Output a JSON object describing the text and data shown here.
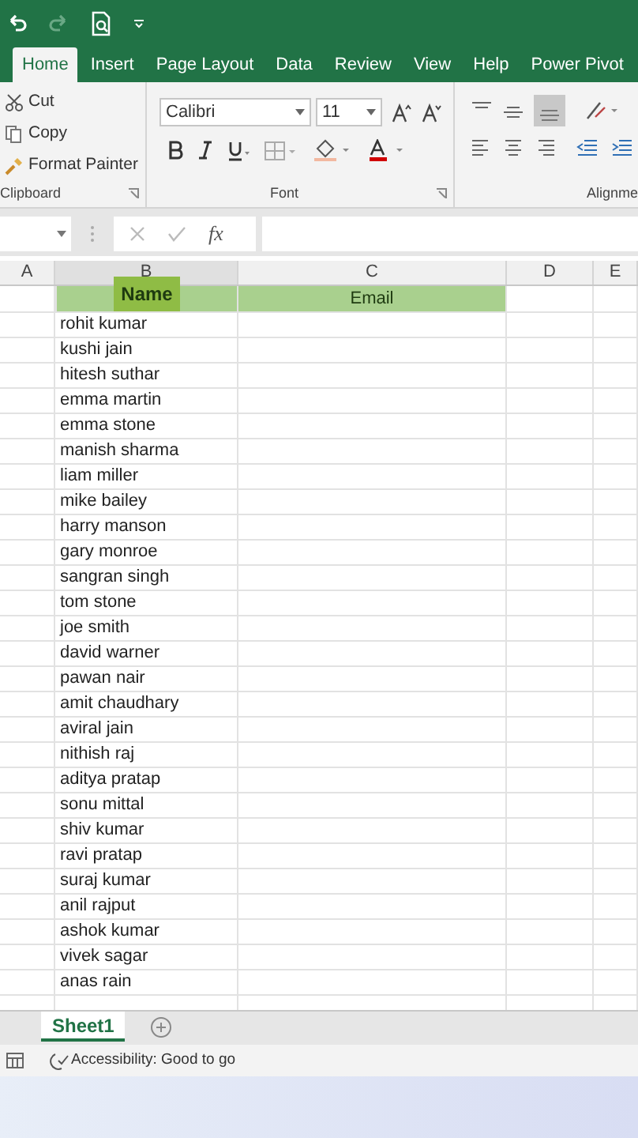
{
  "ribbon_tabs": [
    {
      "label": "Home",
      "selected": true
    },
    {
      "label": "Insert",
      "selected": false
    },
    {
      "label": "Page Layout",
      "selected": false
    },
    {
      "label": "Data",
      "selected": false
    },
    {
      "label": "Review",
      "selected": false
    },
    {
      "label": "View",
      "selected": false
    },
    {
      "label": "Help",
      "selected": false
    },
    {
      "label": "Power Pivot",
      "selected": false
    }
  ],
  "clipboard": {
    "items": [
      "Cut",
      "Copy",
      "Format Painter"
    ],
    "label": "Clipboard"
  },
  "font": {
    "name": "Calibri",
    "size": "11",
    "label": "Font"
  },
  "alignment": {
    "label": "Alignme"
  },
  "formula_bar": {
    "fx": "fx"
  },
  "columns": [
    {
      "label": "A",
      "selected": false
    },
    {
      "label": "B",
      "selected": true
    },
    {
      "label": "C",
      "selected": false
    },
    {
      "label": "D",
      "selected": false
    },
    {
      "label": "E",
      "selected": false
    }
  ],
  "header_row": [
    "Name",
    "Email"
  ],
  "rows": [
    "rohit kumar",
    "kushi jain",
    "hitesh suthar",
    "emma martin",
    "emma stone",
    "manish sharma",
    "liam miller",
    "mike bailey",
    "harry manson",
    "gary monroe",
    "sangran singh",
    "tom stone",
    "joe smith",
    "david warner",
    "pawan nair",
    "amit chaudhary",
    "aviral jain",
    "nithish raj",
    "aditya pratap",
    "sonu mittal",
    "shiv kumar",
    "ravi pratap",
    "suraj kumar",
    "anil rajput",
    "ashok kumar",
    "vivek sagar",
    "anas rain"
  ],
  "sheet_tabs": [
    {
      "label": "Sheet1",
      "selected": true
    }
  ],
  "status_bar": {
    "accessibility": "Accessibility: Good to go"
  }
}
